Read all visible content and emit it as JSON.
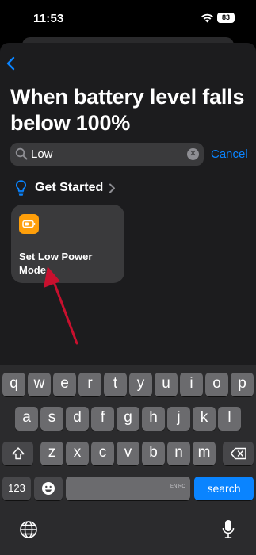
{
  "status_bar": {
    "time": "11:53",
    "battery": "83"
  },
  "header": {
    "title": "When battery level falls below 100%"
  },
  "search": {
    "value": "Low",
    "cancel_label": "Cancel"
  },
  "section": {
    "label": "Get Started"
  },
  "action_card": {
    "label": "Set Low Power Mode",
    "icon": "battery-icon",
    "icon_color": "#ff9f0a"
  },
  "keyboard": {
    "row1": [
      "q",
      "w",
      "e",
      "r",
      "t",
      "y",
      "u",
      "i",
      "o",
      "p"
    ],
    "row2": [
      "a",
      "s",
      "d",
      "f",
      "g",
      "h",
      "j",
      "k",
      "l"
    ],
    "row3": [
      "z",
      "x",
      "c",
      "v",
      "b",
      "n",
      "m"
    ],
    "numbers_label": "123",
    "space_lang": "EN RO",
    "return_label": "search"
  },
  "colors": {
    "accent": "#0a84ff",
    "annotation_arrow": "#c8102e"
  }
}
